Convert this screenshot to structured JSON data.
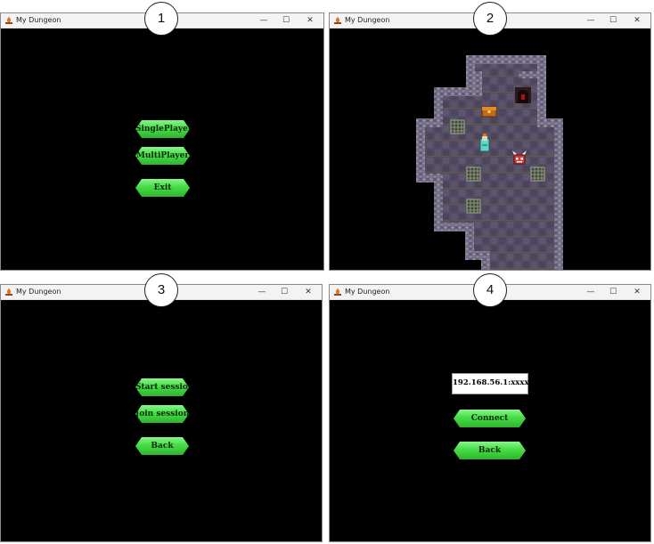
{
  "windows": [
    {
      "title": "My Dungeon",
      "step": "1",
      "controls": {
        "minimize": "—",
        "maximize": "☐",
        "close": "✕"
      },
      "buttons": [
        "SinglePlayer",
        "MultiPlayer",
        "Exit"
      ]
    },
    {
      "title": "My Dungeon",
      "step": "2",
      "controls": {
        "minimize": "—",
        "maximize": "☐",
        "close": "✕"
      }
    },
    {
      "title": "My Dungeon",
      "step": "3",
      "controls": {
        "minimize": "—",
        "maximize": "☐",
        "close": "✕"
      },
      "buttons": [
        "Start session",
        "Join session",
        "Back"
      ]
    },
    {
      "title": "My Dungeon",
      "step": "4",
      "controls": {
        "minimize": "—",
        "maximize": "☐",
        "close": "✕"
      },
      "ip_address": "192.168.56.1:xxxxx",
      "buttons": [
        "Connect",
        "Back"
      ]
    }
  ],
  "colors": {
    "button_green": "#45dd45",
    "dungeon_floor": "#534c63",
    "dungeon_wall": "#6e6780",
    "background": "#000000"
  },
  "icons": {
    "app_icon": "campfire-icon",
    "dungeon_sprites": [
      "treasure-chest-icon",
      "hero-knight-icon",
      "red-demon-icon",
      "dungeon-door-icon",
      "iron-grate-icon"
    ]
  }
}
